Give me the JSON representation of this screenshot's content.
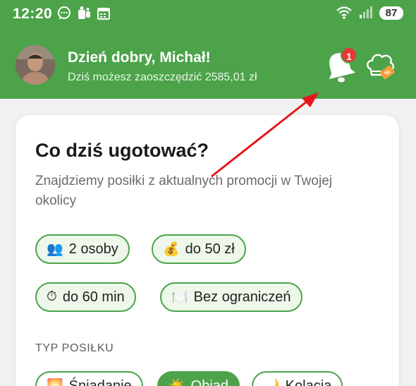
{
  "status_bar": {
    "time": "12:20",
    "battery": "87"
  },
  "header": {
    "greeting": "Dzień dobry, Michał!",
    "subtitle": "Dziś możesz zaoszczędzić 2585,01 zł",
    "notification_count": "1"
  },
  "card": {
    "title": "Co dziś ugotować?",
    "description": "Znajdziemy posiłki z aktualnych promocji w Twojej okolicy",
    "filters": [
      {
        "emoji": "👥",
        "label": "2 osoby"
      },
      {
        "emoji": "💰",
        "label": "do 50 zł"
      },
      {
        "emoji": "⏱",
        "label": "do 60 min"
      },
      {
        "emoji": "🍽️",
        "label": "Bez ograniczeń"
      }
    ],
    "meal_type_heading": "TYP POSIŁKU",
    "meal_types": [
      {
        "emoji": "🌅",
        "label": "Śniadanie"
      },
      {
        "emoji": "☀️",
        "label": "Obiad",
        "selected": true
      },
      {
        "emoji": "🌙",
        "label": "Kolacja"
      }
    ]
  },
  "colors": {
    "brand_green": "#4ca34a",
    "badge_red": "#e53935",
    "annotation_arrow": "#e8141c"
  }
}
